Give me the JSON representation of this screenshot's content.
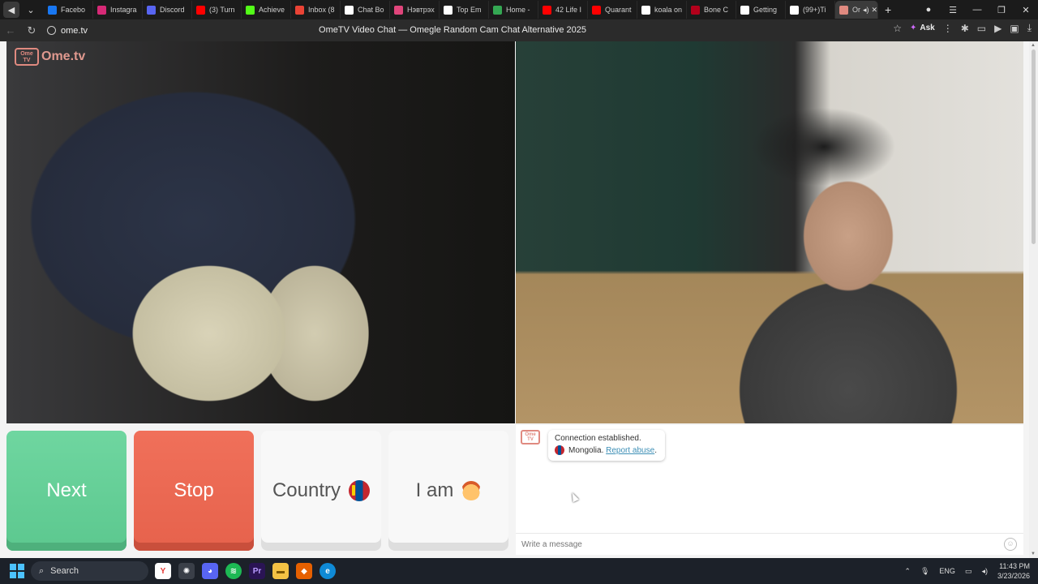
{
  "browser": {
    "tabs": [
      {
        "label": "Facebo",
        "icon": "facebook-icon",
        "color": "#1877f2"
      },
      {
        "label": "Instagra",
        "icon": "instagram-icon",
        "color": "#d62976"
      },
      {
        "label": "Discord",
        "icon": "discord-icon",
        "color": "#5865f2"
      },
      {
        "label": "(3) Turn",
        "icon": "youtube-icon",
        "color": "#ff0000"
      },
      {
        "label": "Achieve",
        "icon": "kick-icon",
        "color": "#53fc18"
      },
      {
        "label": "Inbox (8",
        "icon": "gmail-icon",
        "color": "#ea4335"
      },
      {
        "label": "Chat Bo",
        "icon": "chatbot-icon",
        "color": "#ffffff"
      },
      {
        "label": "Нэвтрэх",
        "icon": "site-icon",
        "color": "#e0457b"
      },
      {
        "label": "Top Em",
        "icon": "site-icon",
        "color": "#ffffff"
      },
      {
        "label": "Home -",
        "icon": "drive-icon",
        "color": "#34a853"
      },
      {
        "label": "42 Life I",
        "icon": "youtube-icon",
        "color": "#ff0000"
      },
      {
        "label": "Quarant",
        "icon": "youtube-icon",
        "color": "#ff0000"
      },
      {
        "label": "koala on",
        "icon": "google-icon",
        "color": "#ffffff"
      },
      {
        "label": "Bone C",
        "icon": "site-icon",
        "color": "#b3001b"
      },
      {
        "label": "Getting",
        "icon": "github-icon",
        "color": "#ffffff"
      },
      {
        "label": "(99+)Ti",
        "icon": "tiktok-icon",
        "color": "#ffffff"
      }
    ],
    "active_tab": {
      "label": "Or",
      "icon": "ometv-icon"
    },
    "url": "ome.tv",
    "page_title": "OmeTV Video Chat — Omegle Random Cam Chat Alternative 2025",
    "ask_label": "Ask"
  },
  "logo": {
    "badge": "Ome TV",
    "text": "Ome.tv"
  },
  "controls": {
    "next_label": "Next",
    "stop_label": "Stop",
    "country_label": "Country",
    "iam_label": "I am"
  },
  "chat": {
    "status": "Connection established.",
    "country": "Mongolia.",
    "report_label": "Report abuse",
    "report_suffix": ".",
    "input_placeholder": "Write a message",
    "bot_badge": "Ome TV"
  },
  "taskbar": {
    "search_label": "Search",
    "language": "ENG",
    "time": "11:43 PM",
    "date": "3/23/2026"
  },
  "colors": {
    "next": "#5cc88f",
    "stop": "#e6624c",
    "brand": "#e08a80",
    "link": "#3d8fb6"
  }
}
